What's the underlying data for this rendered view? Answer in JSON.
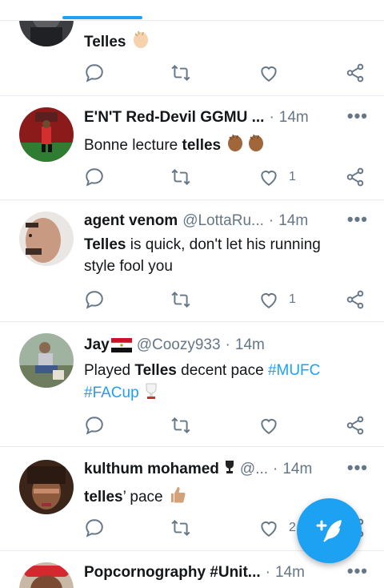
{
  "tweets": [
    {
      "name": "",
      "handle": "",
      "time": "",
      "text_bold": "Telles",
      "text_after": "",
      "likes": "",
      "avatar_icon": "avatar-armor",
      "emoji": [
        "clapping-hands-emoji"
      ]
    },
    {
      "name": "E'N'T Red-Devil GGMU ...",
      "handle": "",
      "time": "14m",
      "text_before": "Bonne lecture ",
      "text_bold": "telles",
      "likes": "1",
      "avatar_icon": "avatar-football",
      "emoji": [
        "clapping-hands-emoji",
        "clapping-hands-emoji"
      ]
    },
    {
      "name": "agent venom",
      "handle": "@LottaRu...",
      "time": "14m",
      "text_bold": "Telles",
      "text_after": " is quick, don't let his running style fool you",
      "likes": "1",
      "avatar_icon": "avatar-face"
    },
    {
      "name": "Jay",
      "handle": "@Coozy933",
      "time": "14m",
      "text_before": "Played ",
      "text_bold": "Telles",
      "text_after": " decent pace ",
      "hashtag1": "#MUFC",
      "hashtag2": "#FACup",
      "likes": "",
      "avatar_icon": "avatar-person-outdoor",
      "flag_icon": "egypt-flag-icon",
      "emoji": [
        "trophy-emoji"
      ]
    },
    {
      "name": "kulthum mohamed",
      "handle": "@...",
      "time": "14m",
      "text_bold": "telles",
      "text_after": "’ pace",
      "likes": "2",
      "avatar_icon": "avatar-woman",
      "emoji": [
        "thumbs-up-emoji"
      ]
    },
    {
      "name": "Popcornography #Unit...",
      "handle": "",
      "time": "14m",
      "avatar_icon": "avatar-red-hat"
    }
  ],
  "more_label": "•••",
  "dot_sep": "·",
  "colors": {
    "accent": "#1da1f2",
    "text": "#14171a",
    "muted": "#657786",
    "divider": "#e6ecf0"
  },
  "fab": {
    "icon": "compose-tweet-icon"
  }
}
